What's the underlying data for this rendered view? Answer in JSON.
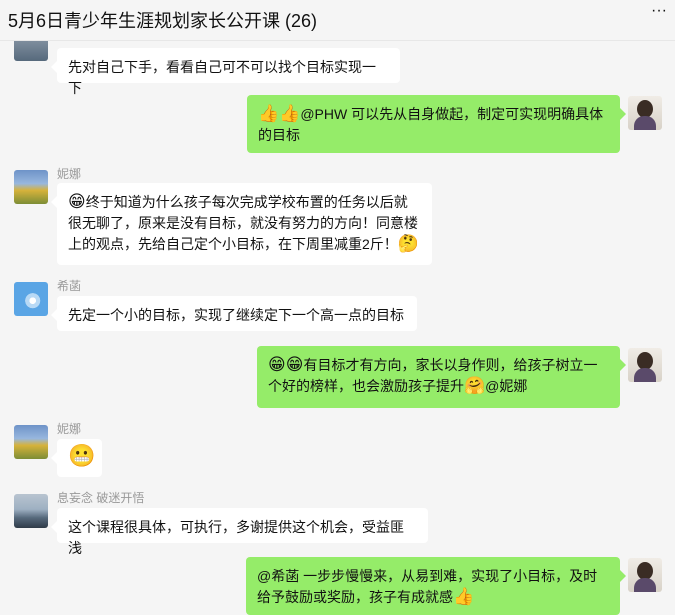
{
  "window": {
    "title": "5月6日青少年生涯规划家长公开课 (26)",
    "more_icon": "···"
  },
  "messages": [
    {
      "side": "left",
      "sender": "",
      "avatar": "top-partial",
      "text": "先对自己下手，看看自己可不可以找个目标实现一下"
    },
    {
      "side": "right",
      "emoji_before": "👍👍",
      "text": "@PHW 可以先从自身做起，制定可实现明确具体的目标",
      "emoji_after": ""
    },
    {
      "side": "left",
      "sender": "妮娜",
      "avatar": "landscape",
      "emoji_before": "😁",
      "text": "终于知道为什么孩子每次完成学校布置的任务以后就很无聊了，原来是没有目标，就没有努力的方向！同意楼上的观点，先给自己定个小目标，在下周里减重2斤！",
      "emoji_after": "🤔"
    },
    {
      "side": "left",
      "sender": "希菡",
      "avatar": "flower",
      "text": "先定一个小的目标，实现了继续定下一个高一点的目标"
    },
    {
      "side": "right",
      "emoji_before": "😁😁",
      "text": "有目标才有方向，家长以身作则，给孩子树立一个好的榜样，也会激励孩子提升",
      "emoji_mid": "🤗",
      "text_after": "@妮娜"
    },
    {
      "side": "left",
      "sender": "妮娜",
      "avatar": "landscape",
      "emoji_only": "😬"
    },
    {
      "side": "left",
      "sender": "息妄念 破迷开悟",
      "avatar": "sea",
      "text": "这个课程很具体，可执行，多谢提供这个机会，受益匪浅"
    },
    {
      "side": "right",
      "text": "@希菡 一步步慢慢来，从易到难，实现了小目标，及时给予鼓励或奖励，孩子有成就感",
      "emoji_after": "👍"
    }
  ]
}
